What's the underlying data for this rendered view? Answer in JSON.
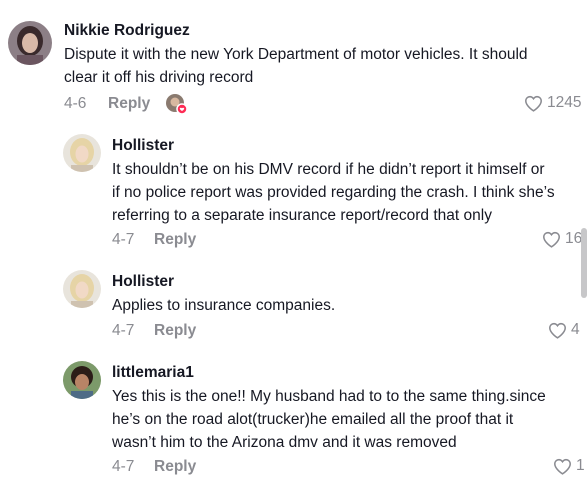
{
  "comments": [
    {
      "author": "Nikkie Rodriguez",
      "lines": [
        "Dispute it with the new York Department of motor vehicles. It should",
        "clear it off his driving record"
      ],
      "date": "4-6",
      "reply_label": "Reply",
      "likes": "1245"
    },
    {
      "author": "Hollister",
      "lines": [
        "It shouldn’t be on his DMV record if he didn’t report it himself or",
        "if no police report was provided regarding the crash. I think she’s",
        "referring to a separate insurance report/record that only"
      ],
      "date": "4-7",
      "reply_label": "Reply",
      "likes": "16"
    },
    {
      "author": "Hollister",
      "lines": [
        "Applies to insurance companies."
      ],
      "date": "4-7",
      "reply_label": "Reply",
      "likes": "4"
    },
    {
      "author": "littlemaria1",
      "lines": [
        "Yes this is the one!! My husband had to to the same thing.since",
        "he’s on the road alot(trucker)he emailed all the proof that it",
        "wasn’t him to the Arizona dmv and it was removed"
      ],
      "date": "4-7",
      "reply_label": "Reply",
      "likes": "1"
    }
  ],
  "colors": {
    "text": "#161823",
    "meta": "#8a8b91",
    "creator_badge": "#fe2c55"
  },
  "icons": [
    "heart-outline-icon",
    "creator-liked-avatar-icon",
    "avatar"
  ]
}
